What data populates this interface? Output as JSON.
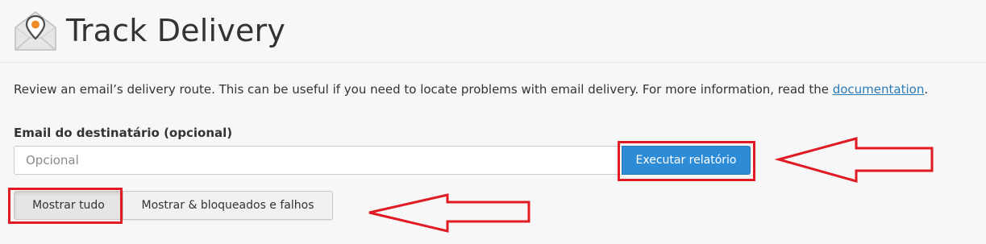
{
  "header": {
    "title": "Track Delivery",
    "icon": "envelope-location-pin-icon"
  },
  "description": {
    "text": "Review an email’s delivery route. This can be useful if you need to locate problems with email delivery. For more information, read the ",
    "link_text": "documentation",
    "trailing": "."
  },
  "form": {
    "recipient_label": "Email do destinatário (opcional)",
    "recipient_placeholder": "Opcional",
    "recipient_value": "",
    "run_button_label": "Executar relatório"
  },
  "filters": {
    "show_all_label": "Mostrar tudo",
    "show_blocked_failed_label": "Mostrar & bloqueados e falhos"
  },
  "colors": {
    "accent": "#2e8bd6",
    "link": "#2a7ab7",
    "annotation": "#e01b24",
    "background": "#f7f7f7"
  },
  "annotations": [
    "highlight-run-button",
    "arrow-to-run-button",
    "highlight-show-all-button",
    "arrow-to-filter-buttons"
  ]
}
